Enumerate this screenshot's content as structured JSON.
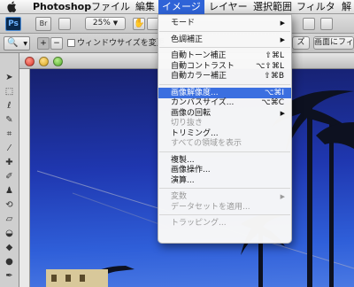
{
  "menubar": {
    "apple": "",
    "items": [
      "Photoshop",
      "ファイル",
      "編集",
      "イメージ",
      "レイヤー",
      "選択範囲",
      "フィルタ",
      "解"
    ]
  },
  "toolbar": {
    "ps_badge": "Ps",
    "br_badge": "Br",
    "zoom_value": "25%",
    "resize_window_label": "ウィンドウサイズを変更",
    "right_button_1": "ズ",
    "right_button_2": "画面にフィ"
  },
  "image_menu": {
    "items": [
      {
        "label": "モード",
        "shortcut": "",
        "submenu": true,
        "disabled": false,
        "selected": false
      },
      {
        "sep": true
      },
      {
        "label": "色調補正",
        "shortcut": "",
        "submenu": true,
        "disabled": false,
        "selected": false
      },
      {
        "sep": true
      },
      {
        "label": "自動トーン補正",
        "shortcut": "⇧⌘L",
        "submenu": false,
        "disabled": false,
        "selected": false
      },
      {
        "label": "自動コントラスト",
        "shortcut": "⌥⇧⌘L",
        "submenu": false,
        "disabled": false,
        "selected": false
      },
      {
        "label": "自動カラー補正",
        "shortcut": "⇧⌘B",
        "submenu": false,
        "disabled": false,
        "selected": false
      },
      {
        "sep": true
      },
      {
        "label": "画像解像度...",
        "shortcut": "⌥⌘I",
        "submenu": false,
        "disabled": false,
        "selected": true
      },
      {
        "label": "カンバスサイズ...",
        "shortcut": "⌥⌘C",
        "submenu": false,
        "disabled": false,
        "selected": false
      },
      {
        "label": "画像の回転",
        "shortcut": "",
        "submenu": true,
        "disabled": false,
        "selected": false
      },
      {
        "label": "切り抜き",
        "shortcut": "",
        "submenu": false,
        "disabled": true,
        "selected": false
      },
      {
        "label": "トリミング...",
        "shortcut": "",
        "submenu": false,
        "disabled": false,
        "selected": false
      },
      {
        "label": "すべての領域を表示",
        "shortcut": "",
        "submenu": false,
        "disabled": true,
        "selected": false
      },
      {
        "sep": true
      },
      {
        "label": "複製...",
        "shortcut": "",
        "submenu": false,
        "disabled": false,
        "selected": false
      },
      {
        "label": "画像操作...",
        "shortcut": "",
        "submenu": false,
        "disabled": false,
        "selected": false
      },
      {
        "label": "演算...",
        "shortcut": "",
        "submenu": false,
        "disabled": false,
        "selected": false
      },
      {
        "sep": true
      },
      {
        "label": "変数",
        "shortcut": "",
        "submenu": true,
        "disabled": true,
        "selected": false
      },
      {
        "label": "データセットを適用...",
        "shortcut": "",
        "submenu": false,
        "disabled": true,
        "selected": false
      },
      {
        "sep": true
      },
      {
        "label": "トラッピング...",
        "shortcut": "",
        "submenu": false,
        "disabled": true,
        "selected": false
      }
    ]
  },
  "colors": {
    "menu_highlight": "#3b6fe0",
    "menubar_active": "#2f63d7",
    "sky": "#1f37b0"
  }
}
